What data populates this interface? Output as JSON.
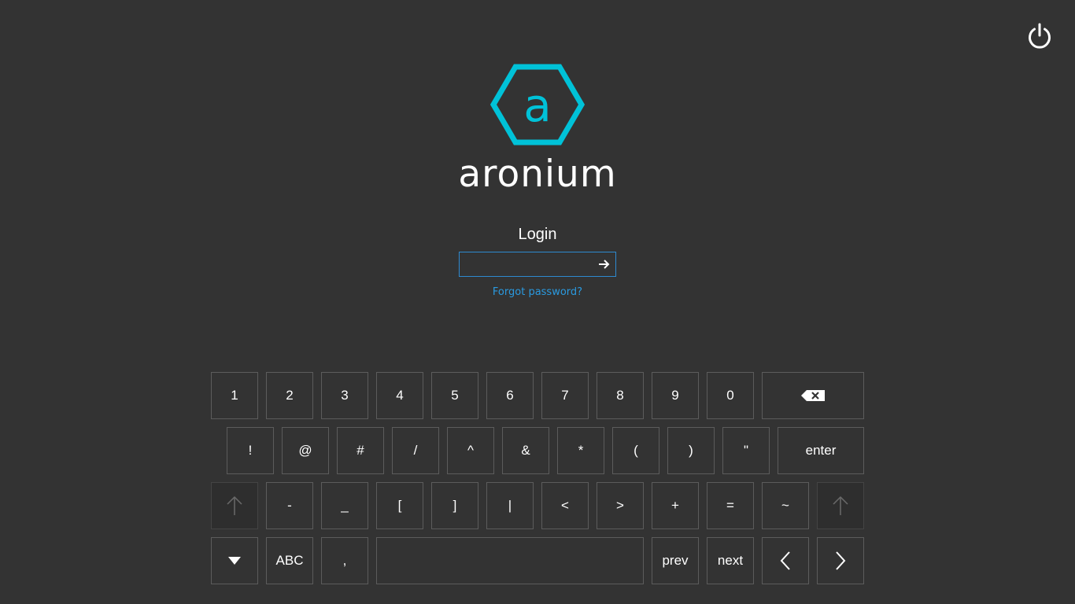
{
  "brand": {
    "logo_letter": "a",
    "name": "aronium",
    "color": "#00c2d8"
  },
  "login": {
    "label": "Login",
    "value": "",
    "placeholder": "",
    "forgot_password": "Forgot password?",
    "accent": "#2a9ae0"
  },
  "header": {
    "power_icon": "power-icon"
  },
  "keyboard": {
    "row1": [
      "1",
      "2",
      "3",
      "4",
      "5",
      "6",
      "7",
      "8",
      "9",
      "0"
    ],
    "backspace_icon": "backspace-icon",
    "row2": [
      "!",
      "@",
      "#",
      "/",
      "^",
      "&",
      "*",
      "(",
      ")",
      "\""
    ],
    "enter": "enter",
    "shift_icon": "shift-arrow-up-icon",
    "row3": [
      "-",
      "_",
      "[",
      "]",
      "|",
      "<",
      ">",
      "+",
      "=",
      "~"
    ],
    "hide_icon": "triangle-down-icon",
    "abc": "ABC",
    "comma": ",",
    "space": "",
    "prev": "prev",
    "next": "next",
    "left_icon": "chevron-left-icon",
    "right_icon": "chevron-right-icon"
  }
}
